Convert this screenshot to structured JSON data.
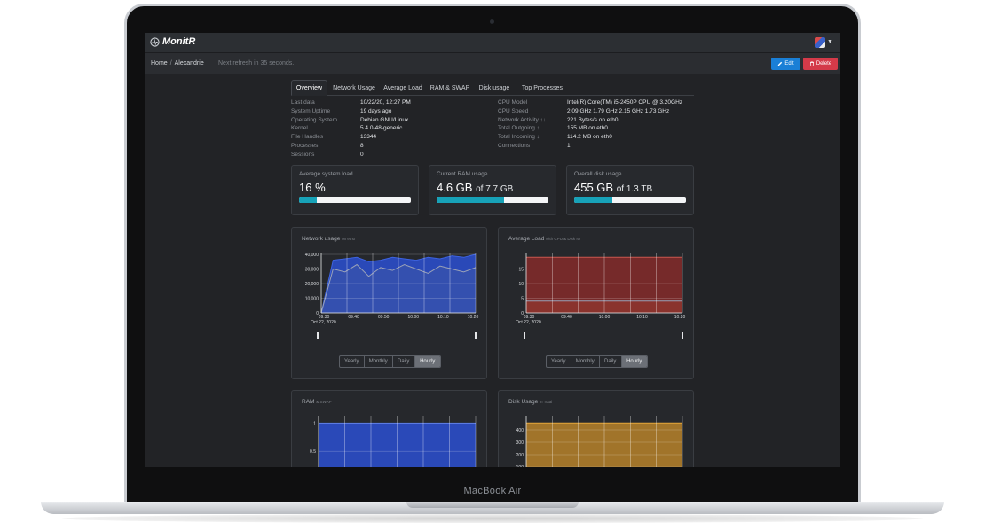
{
  "device": {
    "name": "MacBook Air"
  },
  "app": {
    "name": "MonitR"
  },
  "breadcrumb": {
    "home": "Home",
    "sep": "/",
    "current": "Alexandrie"
  },
  "refresh_text": "Next refresh in 35 seconds.",
  "actions": {
    "edit": "Edit",
    "delete": "Delete"
  },
  "tabs": [
    "Overview",
    "Network Usage",
    "Average Load",
    "RAM & SWAP",
    "Disk usage",
    "Top Processes"
  ],
  "active_tab": "Overview",
  "info_left": [
    {
      "label": "Last data",
      "value": "10/22/20, 12:27 PM"
    },
    {
      "label": "System Uptime",
      "value": "19 days ago"
    },
    {
      "label": "Operating System",
      "value": "Debian GNU/Linux"
    },
    {
      "label": "Kernel",
      "value": "5.4.0-48-generic"
    },
    {
      "label": "File Handles",
      "value": "13344"
    },
    {
      "label": "Processes",
      "value": "8"
    },
    {
      "label": "Sessions",
      "value": "0"
    }
  ],
  "info_right": [
    {
      "label": "CPU Model",
      "value": "Intel(R) Core(TM) i5-2450P CPU @ 3.20GHz"
    },
    {
      "label": "CPU Speed",
      "value": "2.09 GHz 1.79 GHz 2.15 GHz 1.73 GHz"
    },
    {
      "label": "Network Activity ↑↓",
      "value": "221 Bytes/s on eth0"
    },
    {
      "label": "Total Outgoing ↑",
      "value": "155 MB on eth0"
    },
    {
      "label": "Total Incoming ↓",
      "value": "114.2 MB on eth0"
    },
    {
      "label": "Connections",
      "value": "1"
    }
  ],
  "stats": {
    "load": {
      "title": "Average system load",
      "value": "16 %",
      "fraction": 0.16
    },
    "ram": {
      "title": "Current RAM usage",
      "value": "4.6 GB",
      "of": "of 7.7 GB",
      "fraction": 0.6
    },
    "disk": {
      "title": "Overall disk usage",
      "value": "455 GB",
      "of": "of 1.3 TB",
      "fraction": 0.34
    }
  },
  "panels": {
    "network": {
      "title": "Network usage",
      "subtitle": "on eth0"
    },
    "load": {
      "title": "Average Load",
      "subtitle": "with CPU & Disk IO"
    },
    "ram": {
      "title": "RAM",
      "subtitle": "& SWAP"
    },
    "disk": {
      "title": "Disk Usage",
      "subtitle": "in Total"
    }
  },
  "ranges": [
    "Yearly",
    "Monthly",
    "Daily",
    "Hourly"
  ],
  "active_range": "Hourly",
  "colors": {
    "accent": "#17a2b8",
    "edit": "#1a7fd6",
    "delete": "#d43a49",
    "network": "#2f4fc4",
    "load": "#8a2f2f",
    "ram": "#2f4fc4",
    "disk": "#b8862b"
  },
  "chart_data": [
    {
      "type": "area",
      "title": "Network usage",
      "subtitle": "on eth0",
      "x": [
        "09:30",
        "09:40",
        "09:50",
        "10:00",
        "10:10",
        "10:20"
      ],
      "x_date": "Oct 22, 2020",
      "ylim": [
        0,
        40000
      ],
      "yticks": [
        "0",
        "10,000",
        "20,000",
        "30,000",
        "40,000"
      ],
      "series": [
        {
          "values": [
            0,
            36000,
            37000,
            38000,
            35000,
            36000,
            38000,
            37000,
            36000,
            38000,
            37000,
            39000,
            38000,
            40000
          ]
        },
        {
          "values": [
            0,
            30000,
            28000,
            33000,
            25000,
            31000,
            29000,
            33000,
            30000,
            27000,
            32000,
            30000,
            28000,
            31000
          ]
        }
      ]
    },
    {
      "type": "area",
      "title": "Average Load",
      "subtitle": "with CPU & Disk IO",
      "x": [
        "09:30",
        "09:40",
        "10:00",
        "10:10",
        "10:20"
      ],
      "x_date": "Oct 22, 2020",
      "ylim": [
        0,
        20
      ],
      "yticks": [
        "0",
        "5",
        "10",
        "15"
      ],
      "series": [
        {
          "values": [
            19,
            19,
            19,
            19,
            19,
            19,
            19,
            19
          ]
        },
        {
          "values": [
            4,
            4,
            4,
            4,
            4,
            4,
            4,
            4
          ]
        }
      ]
    },
    {
      "type": "area",
      "title": "RAM",
      "subtitle": "& SWAP",
      "ylim": [
        0,
        1.1
      ],
      "yticks": [
        "0.5",
        "1"
      ],
      "series": [
        {
          "values": [
            1,
            1,
            1,
            1,
            1,
            1,
            1,
            1
          ]
        },
        {
          "values": [
            0.05,
            0.04,
            0.05,
            0.04,
            0.06,
            0.05,
            0.04,
            0.05
          ]
        }
      ]
    },
    {
      "type": "area",
      "title": "Disk Usage",
      "subtitle": "in Total",
      "ylim": [
        0,
        500
      ],
      "yticks": [
        "100",
        "200",
        "300",
        "400"
      ],
      "series": [
        {
          "values": [
            455,
            455,
            455,
            455,
            455,
            455,
            455,
            455
          ]
        }
      ]
    }
  ]
}
